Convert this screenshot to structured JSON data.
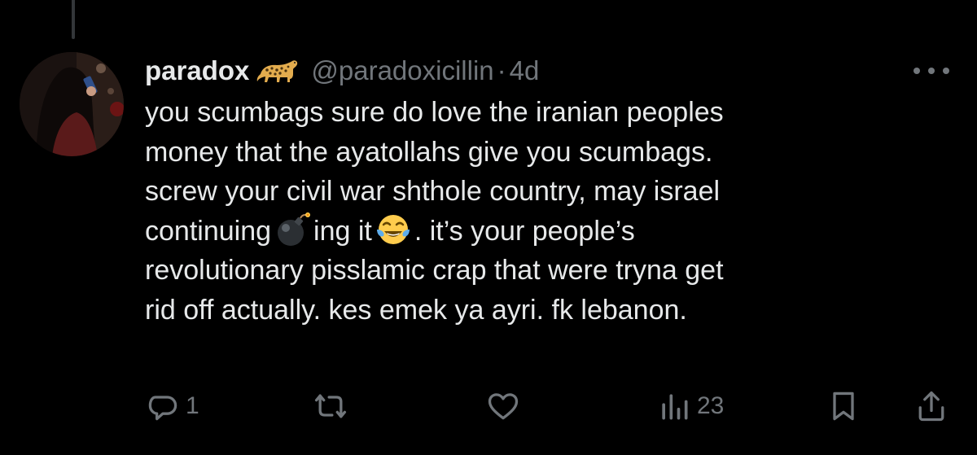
{
  "tweet": {
    "display_name": "paradox",
    "badge_icon": "leopard-emoji",
    "handle": "@paradoxicillin",
    "separator": "·",
    "time": "4d",
    "body_lines": {
      "l1": "you scumbags sure do love the iranian peoples",
      "l2": "money that the ayatollahs give you scumbags.",
      "l3": "screw your civil war shthole country, may israel",
      "l4a": "continuing",
      "l4b": "ing it",
      "l4c": ". it’s your people’s",
      "l5": "revolutionary pisslamic crap that were tryna get",
      "l6": "rid off actually. kes emek ya ayri. fk lebanon."
    },
    "emojis": [
      "bomb-emoji",
      "tears-of-joy-emoji"
    ]
  },
  "actions": {
    "reply_count": "1",
    "retweet_count": "",
    "like_count": "",
    "views_count": "23"
  },
  "colors": {
    "background": "#000000",
    "text_primary": "#e7e9ea",
    "text_secondary": "#71767b"
  }
}
